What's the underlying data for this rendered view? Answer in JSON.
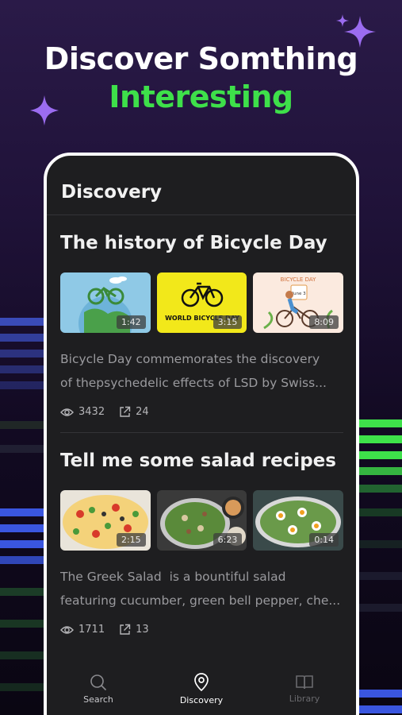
{
  "promo": {
    "line1": "Discover Somthing",
    "line2": "Interesting"
  },
  "app": {
    "title": "Discovery"
  },
  "cards": [
    {
      "title": "The history of Bicycle Day",
      "thumbs": [
        {
          "duration": "1:42",
          "icon": "globe-bicycle-image"
        },
        {
          "duration": "3:15",
          "icon": "world-bicycle-day-image",
          "caption": "WORLD BICYCLE DAY"
        },
        {
          "duration": "8:09",
          "icon": "cyclist-illustration-image",
          "caption": "BICYCLE DAY",
          "date": "June 3"
        }
      ],
      "description": "Bicycle Day commemorates the discovery",
      "description2": "of thepsychedelic effects of LSD by Swiss...",
      "views": "3432",
      "shares": "24"
    },
    {
      "title": "Tell me some salad recipes",
      "thumbs": [
        {
          "duration": "2:15",
          "icon": "pasta-salad-image"
        },
        {
          "duration": "6:23",
          "icon": "green-salad-image"
        },
        {
          "duration": "0:14",
          "icon": "egg-salad-image"
        }
      ],
      "description": "The Greek Salad  is a bountiful salad",
      "description2": "featuring cucumber, green bell pepper, che...",
      "views": "1711",
      "shares": "13"
    }
  ],
  "nav": {
    "search": "Search",
    "discovery": "Discovery",
    "library": "Library"
  },
  "colors": {
    "accent_green": "#3ee04a",
    "stripe_blue": "#3a56e0",
    "background": "#1e1e20"
  }
}
